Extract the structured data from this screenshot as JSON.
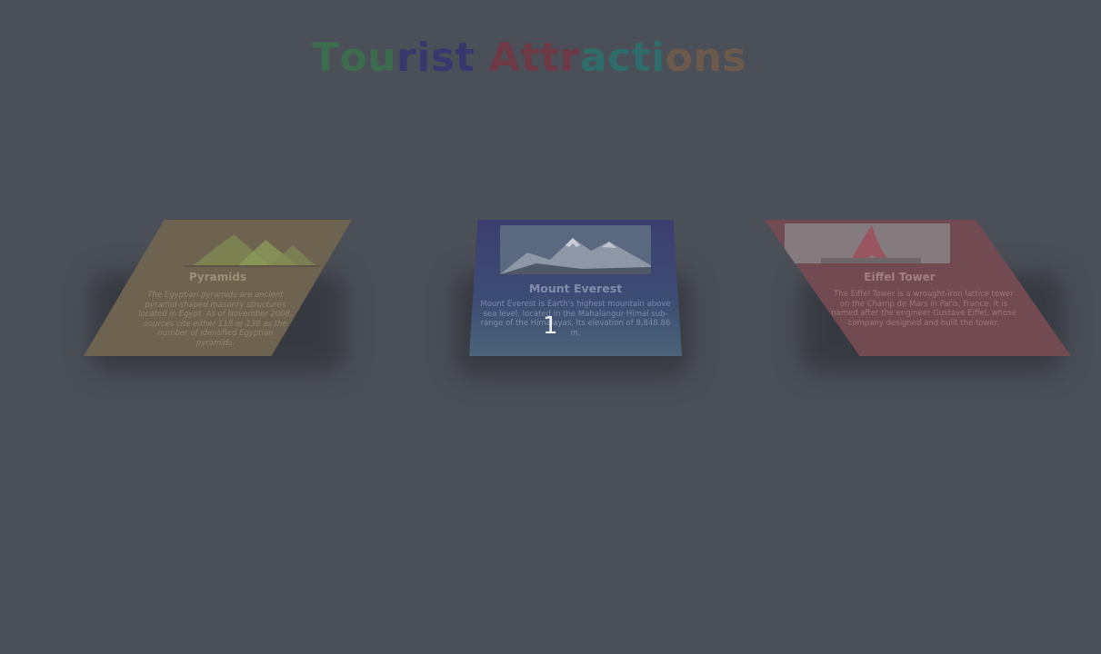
{
  "page_title_letters": [
    {
      "ch": "T",
      "color": "#3d6b4e"
    },
    {
      "ch": "o",
      "color": "#3d6b4e"
    },
    {
      "ch": "u",
      "color": "#3d6b4e"
    },
    {
      "ch": "r",
      "color": "#38386e"
    },
    {
      "ch": "i",
      "color": "#38386e"
    },
    {
      "ch": "s",
      "color": "#38386e"
    },
    {
      "ch": "t",
      "color": "#38386e"
    },
    {
      "ch": " ",
      "color": "#4b4f57"
    },
    {
      "ch": "A",
      "color": "#6e3a45"
    },
    {
      "ch": "t",
      "color": "#6e3a45"
    },
    {
      "ch": "t",
      "color": "#6e3a45"
    },
    {
      "ch": "r",
      "color": "#6e3a45"
    },
    {
      "ch": "a",
      "color": "#2f6b6a"
    },
    {
      "ch": "c",
      "color": "#2f6b6a"
    },
    {
      "ch": "t",
      "color": "#2f6b6a"
    },
    {
      "ch": "i",
      "color": "#2f6b6a"
    },
    {
      "ch": "o",
      "color": "#6b5a4c"
    },
    {
      "ch": "n",
      "color": "#6b5a4c"
    },
    {
      "ch": "s",
      "color": "#6b5a4c"
    }
  ],
  "cards": {
    "pyramids": {
      "name": "Pyramids",
      "description": "The Egyptian pyramids are ancient pyramid-shaped masonry structures located in Egypt. As of November 2008, sources cite either 118 or 138 as the number of identified Egyptian pyramids.",
      "icon": "pyramids-icon",
      "accent": "#6e6251"
    },
    "everest": {
      "name": "Mount Everest",
      "description": "Mount Everest is Earth's highest mountain above sea level, located in the Mahalangur Himal sub-range of the Himalayas. Its elevation of 8,848.86 m.",
      "icon": "mountain-photo",
      "accent": "#3b3e6e"
    },
    "eiffel": {
      "name": "Eiffel Tower",
      "description": "The Eiffel Tower is a wrought-iron lattice tower on the Champ de Mars in Paris, France. It is named after the engineer Gustave Eiffel, whose company designed and built the tower.",
      "icon": "eiffel-tower-photo",
      "accent": "#714a52"
    }
  },
  "slide_number": "1"
}
